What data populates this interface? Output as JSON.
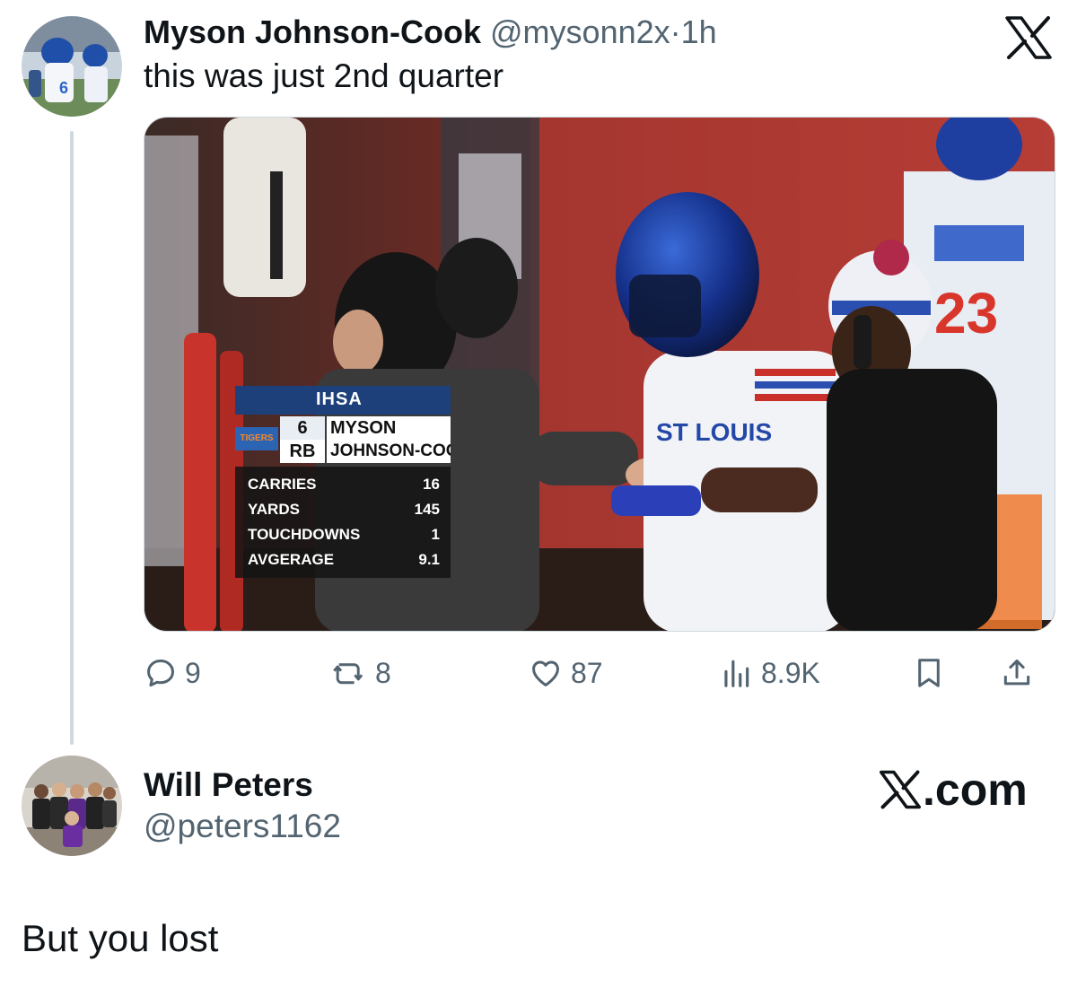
{
  "tweet": {
    "author_name": "Myson Johnson-Cook",
    "author_handle": "@mysonn2x",
    "separator": "·",
    "time": "1h",
    "text": "this was just 2nd quarter",
    "avatar_icon": "profile-photo-football-player",
    "media": {
      "type": "photo",
      "scorebug": {
        "org": "IHSA",
        "team": "TIGERS",
        "number": "6",
        "position": "RB",
        "first_name": "MYSON",
        "last_name": "JOHNSON-COOK",
        "stats": [
          {
            "label": "CARRIES",
            "value": "16"
          },
          {
            "label": "YARDS",
            "value": "145"
          },
          {
            "label": "TOUCHDOWNS",
            "value": "1"
          },
          {
            "label": "AVGERAGE",
            "value": "9.1"
          }
        ],
        "jersey_text": "ST LOUIS",
        "jersey_number": "23"
      }
    },
    "actions": {
      "replies": "9",
      "reposts": "8",
      "likes": "87",
      "views": "8.9K"
    }
  },
  "reply": {
    "author_name": "Will Peters",
    "author_handle": "@peters1162",
    "text": "But you lost",
    "avatar_icon": "profile-photo-group"
  },
  "branding": {
    "watermark": ".com",
    "logo_icon": "x-logo-icon"
  },
  "colors": {
    "text": "#0f1419",
    "secondary": "#536471",
    "thread_line": "#cfd9de"
  }
}
